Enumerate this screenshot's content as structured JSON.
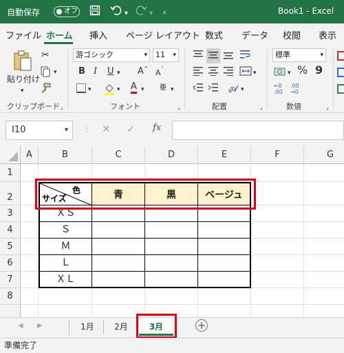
{
  "titlebar": {
    "autosave_label": "自動保存",
    "autosave_state": "オフ",
    "title": "Book1 - Excel"
  },
  "tabs": [
    "ファイル",
    "ホーム",
    "挿入",
    "ページ レイアウト",
    "数式",
    "データ",
    "校閲",
    "表示"
  ],
  "ribbon": {
    "clipboard": {
      "paste_label": "貼り付け",
      "group": "クリップボード"
    },
    "font": {
      "name": "游ゴシック",
      "size": "11",
      "group": "フォント",
      "bold": "B",
      "italic": "I",
      "underline": "U",
      "grow": "A",
      "shrink": "A",
      "color_label": "A",
      "phonetic": "亜"
    },
    "alignment": {
      "group": "配置"
    },
    "number": {
      "format": "標準",
      "group": "数値",
      "percent": "%",
      "comma": "9"
    }
  },
  "formula_bar": {
    "namebox": "I10",
    "fx": "fx",
    "value": ""
  },
  "columns": [
    "A",
    "B",
    "C",
    "D",
    "E",
    "F",
    "G"
  ],
  "rows": [
    "1",
    "2",
    "3",
    "4",
    "5",
    "6",
    "7",
    "8"
  ],
  "table": {
    "header_color": "色",
    "header_size": "サイズ",
    "col_headers": [
      "青",
      "黒",
      "ベージュ"
    ],
    "sizes": [
      "ＸＳ",
      "Ｓ",
      "Ｍ",
      "Ｌ",
      "ＸＬ"
    ]
  },
  "sheets": [
    "1月",
    "2月",
    "3月"
  ],
  "status": "準備完了",
  "colors": {
    "excel_green": "#217346",
    "highlight_red": "#e60012",
    "header_fill": "#fff2cc"
  }
}
